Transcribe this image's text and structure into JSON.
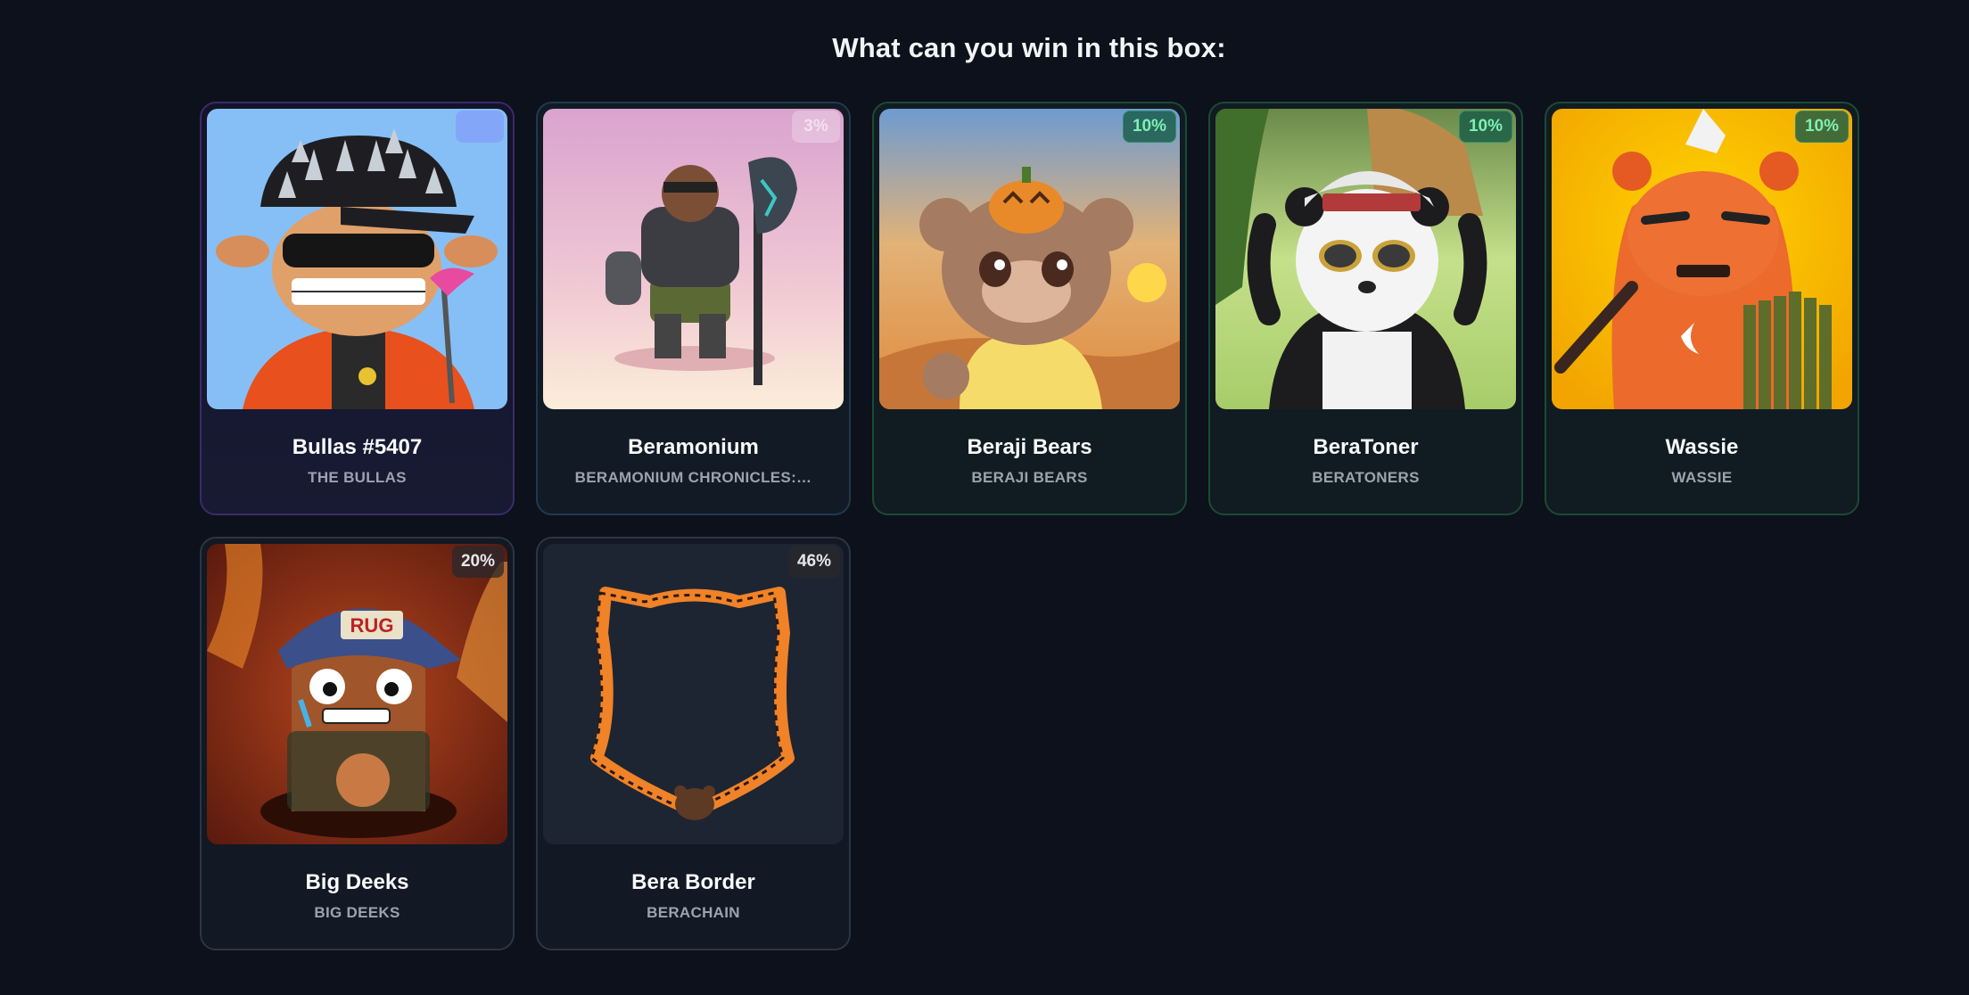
{
  "heading": "What can you win in this box:",
  "cards": [
    {
      "name": "Bullas #5407",
      "collection": "THE BULLAS",
      "chance": ""
    },
    {
      "name": "Beramonium",
      "collection": "BERAMONIUM CHRONICLES:…",
      "chance": "3%"
    },
    {
      "name": "Beraji Bears",
      "collection": "BERAJI BEARS",
      "chance": "10%"
    },
    {
      "name": "BeraToner",
      "collection": "BERATONERS",
      "chance": "10%"
    },
    {
      "name": "Wassie",
      "collection": "WASSIE",
      "chance": "10%"
    },
    {
      "name": "Big Deeks",
      "collection": "BIG DEEKS",
      "chance": "20%"
    },
    {
      "name": "Bera Border",
      "collection": "BERACHAIN",
      "chance": "46%"
    }
  ],
  "colors": {
    "background": "#0c111b",
    "green_badge_text": "#7ef0b4",
    "purple_border": "#3a2b6b"
  }
}
